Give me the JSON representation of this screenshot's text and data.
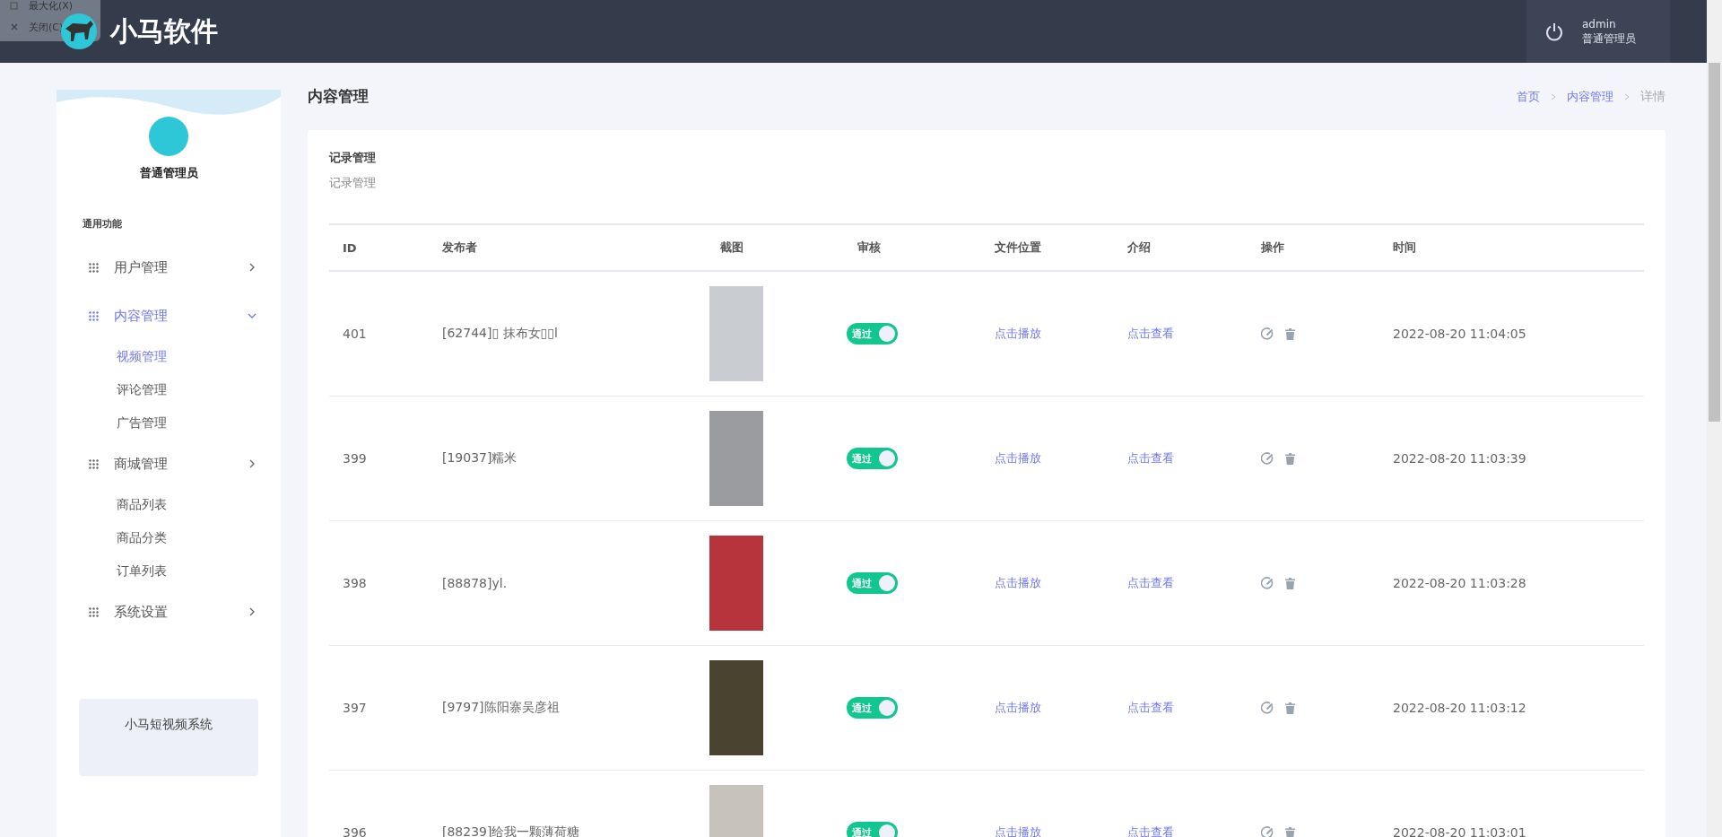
{
  "window_menu": {
    "items": [
      {
        "label": "最大化(X)"
      },
      {
        "label": "关闭(C)"
      }
    ]
  },
  "header": {
    "brand": "小马软件",
    "user": {
      "name": "admin",
      "role": "普通管理员"
    }
  },
  "sidebar": {
    "role": "普通管理员",
    "section": "通用功能",
    "items": [
      {
        "label": "用户管理",
        "expanded": false,
        "selected": false
      },
      {
        "label": "内容管理",
        "expanded": true,
        "selected": true,
        "children": [
          {
            "label": "视频管理",
            "selected": true
          },
          {
            "label": "评论管理",
            "selected": false
          },
          {
            "label": "广告管理",
            "selected": false
          }
        ]
      },
      {
        "label": "商城管理",
        "expanded": false,
        "selected": false,
        "children": [
          {
            "label": "商品列表",
            "selected": false
          },
          {
            "label": "商品分类",
            "selected": false
          },
          {
            "label": "订单列表",
            "selected": false
          }
        ]
      },
      {
        "label": "系统设置",
        "expanded": false,
        "selected": false
      }
    ],
    "footer": "小马短视频系统"
  },
  "page": {
    "title": "内容管理",
    "breadcrumb": [
      {
        "label": "首页",
        "link": true
      },
      {
        "label": "内容管理",
        "link": true
      },
      {
        "label": "详情",
        "link": false
      }
    ]
  },
  "card": {
    "title": "记录管理",
    "subtitle": "记录管理"
  },
  "table": {
    "columns": [
      "ID",
      "发布者",
      "截图",
      "审核",
      "文件位置",
      "介绍",
      "操作",
      "时间"
    ],
    "rows": [
      {
        "id": "401",
        "publisher": "[62744]▯ 抹布女▯▯l",
        "review": {
          "label": "通过",
          "on": true
        },
        "file": "点击播放",
        "intro": "点击查看",
        "time": "2022-08-20 11:04:05"
      },
      {
        "id": "399",
        "publisher": "[19037]糯米",
        "review": {
          "label": "通过",
          "on": true
        },
        "file": "点击播放",
        "intro": "点击查看",
        "time": "2022-08-20 11:03:39"
      },
      {
        "id": "398",
        "publisher": "[88878]yl.",
        "review": {
          "label": "通过",
          "on": true
        },
        "file": "点击播放",
        "intro": "点击查看",
        "time": "2022-08-20 11:03:28"
      },
      {
        "id": "397",
        "publisher": "[9797]陈阳寨吴彦祖",
        "review": {
          "label": "通过",
          "on": true
        },
        "file": "点击播放",
        "intro": "点击查看",
        "time": "2022-08-20 11:03:12"
      },
      {
        "id": "396",
        "publisher": "[88239]给我一颗薄荷糖",
        "review": {
          "label": "通过",
          "on": true
        },
        "file": "点击播放",
        "intro": "点击查看",
        "time": "2022-08-20 11:03:01"
      }
    ]
  }
}
